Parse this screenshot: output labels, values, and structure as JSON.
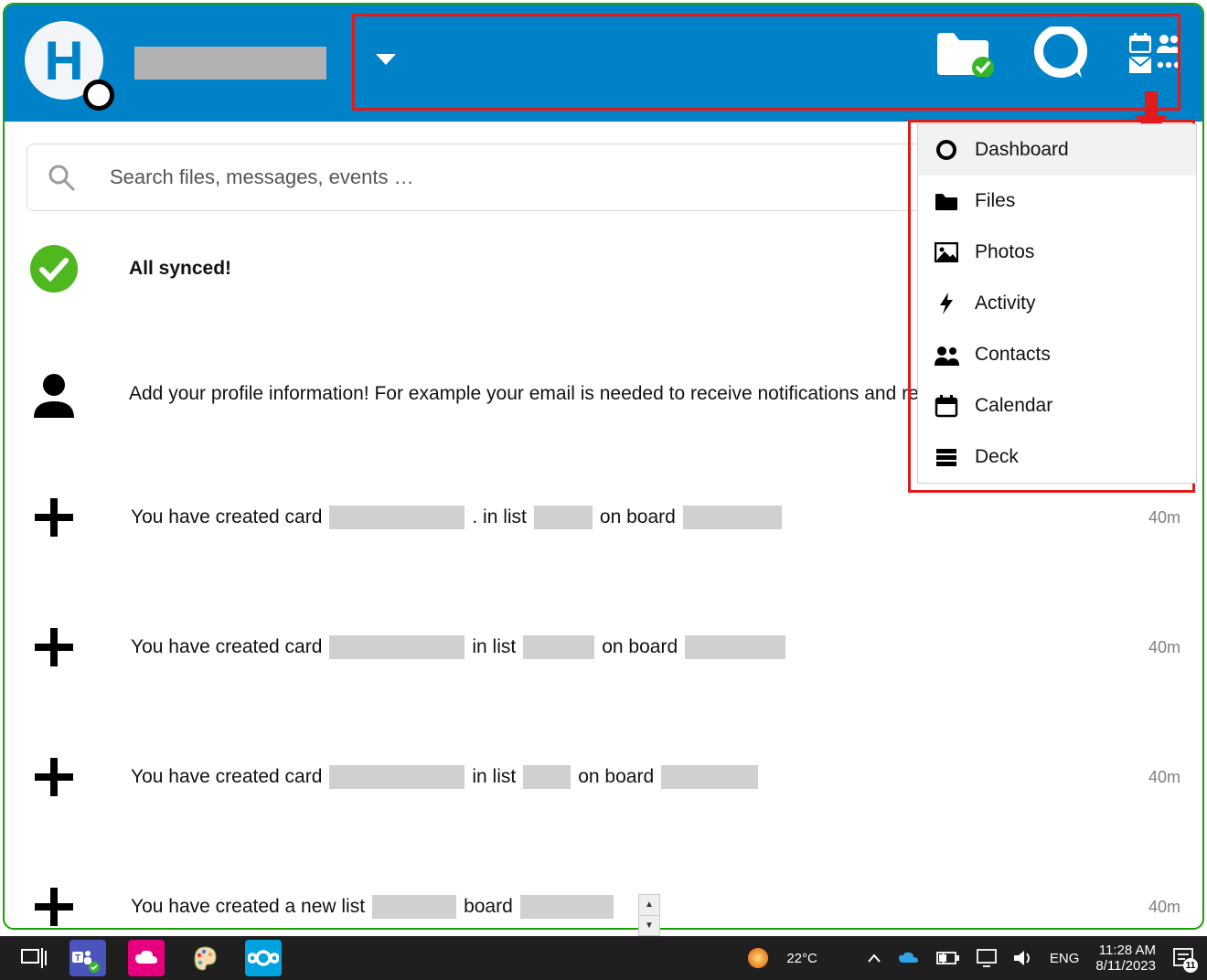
{
  "header": {
    "initial": "H"
  },
  "search": {
    "placeholder": "Search files, messages, events …"
  },
  "status": {
    "synced_text": "All synced!"
  },
  "profile_prompt": "Add your profile information! For example your email is needed to receive notifications and reset your password.",
  "activities": [
    {
      "prefix": "You have created card",
      "mid1": ". in list",
      "mid2": "on board",
      "time": "40m",
      "r1": 148,
      "r2": 64,
      "r3": 108
    },
    {
      "prefix": "You have created card",
      "mid1": "in list",
      "mid2": "on board",
      "time": "40m",
      "r1": 148,
      "r2": 78,
      "r3": 110
    },
    {
      "prefix": "You have created card",
      "mid1": "in list",
      "mid2": "on board",
      "time": "40m",
      "r1": 148,
      "r2": 52,
      "r3": 106
    },
    {
      "prefix": "You have created a new list",
      "mid1": "board",
      "mid2": "",
      "time": "40m",
      "r1": 92,
      "r2": 102,
      "r3": 0
    }
  ],
  "dropdown": {
    "items": [
      {
        "label": "Dashboard",
        "icon": "circle-outline"
      },
      {
        "label": "Files",
        "icon": "folder-solid"
      },
      {
        "label": "Photos",
        "icon": "image"
      },
      {
        "label": "Activity",
        "icon": "bolt"
      },
      {
        "label": "Contacts",
        "icon": "contacts"
      },
      {
        "label": "Calendar",
        "icon": "calendar"
      },
      {
        "label": "Deck",
        "icon": "deck"
      }
    ]
  },
  "taskbar": {
    "temp": "22°C",
    "lang": "ENG",
    "time": "11:28 AM",
    "date": "8/11/2023",
    "noti_count": "11"
  }
}
